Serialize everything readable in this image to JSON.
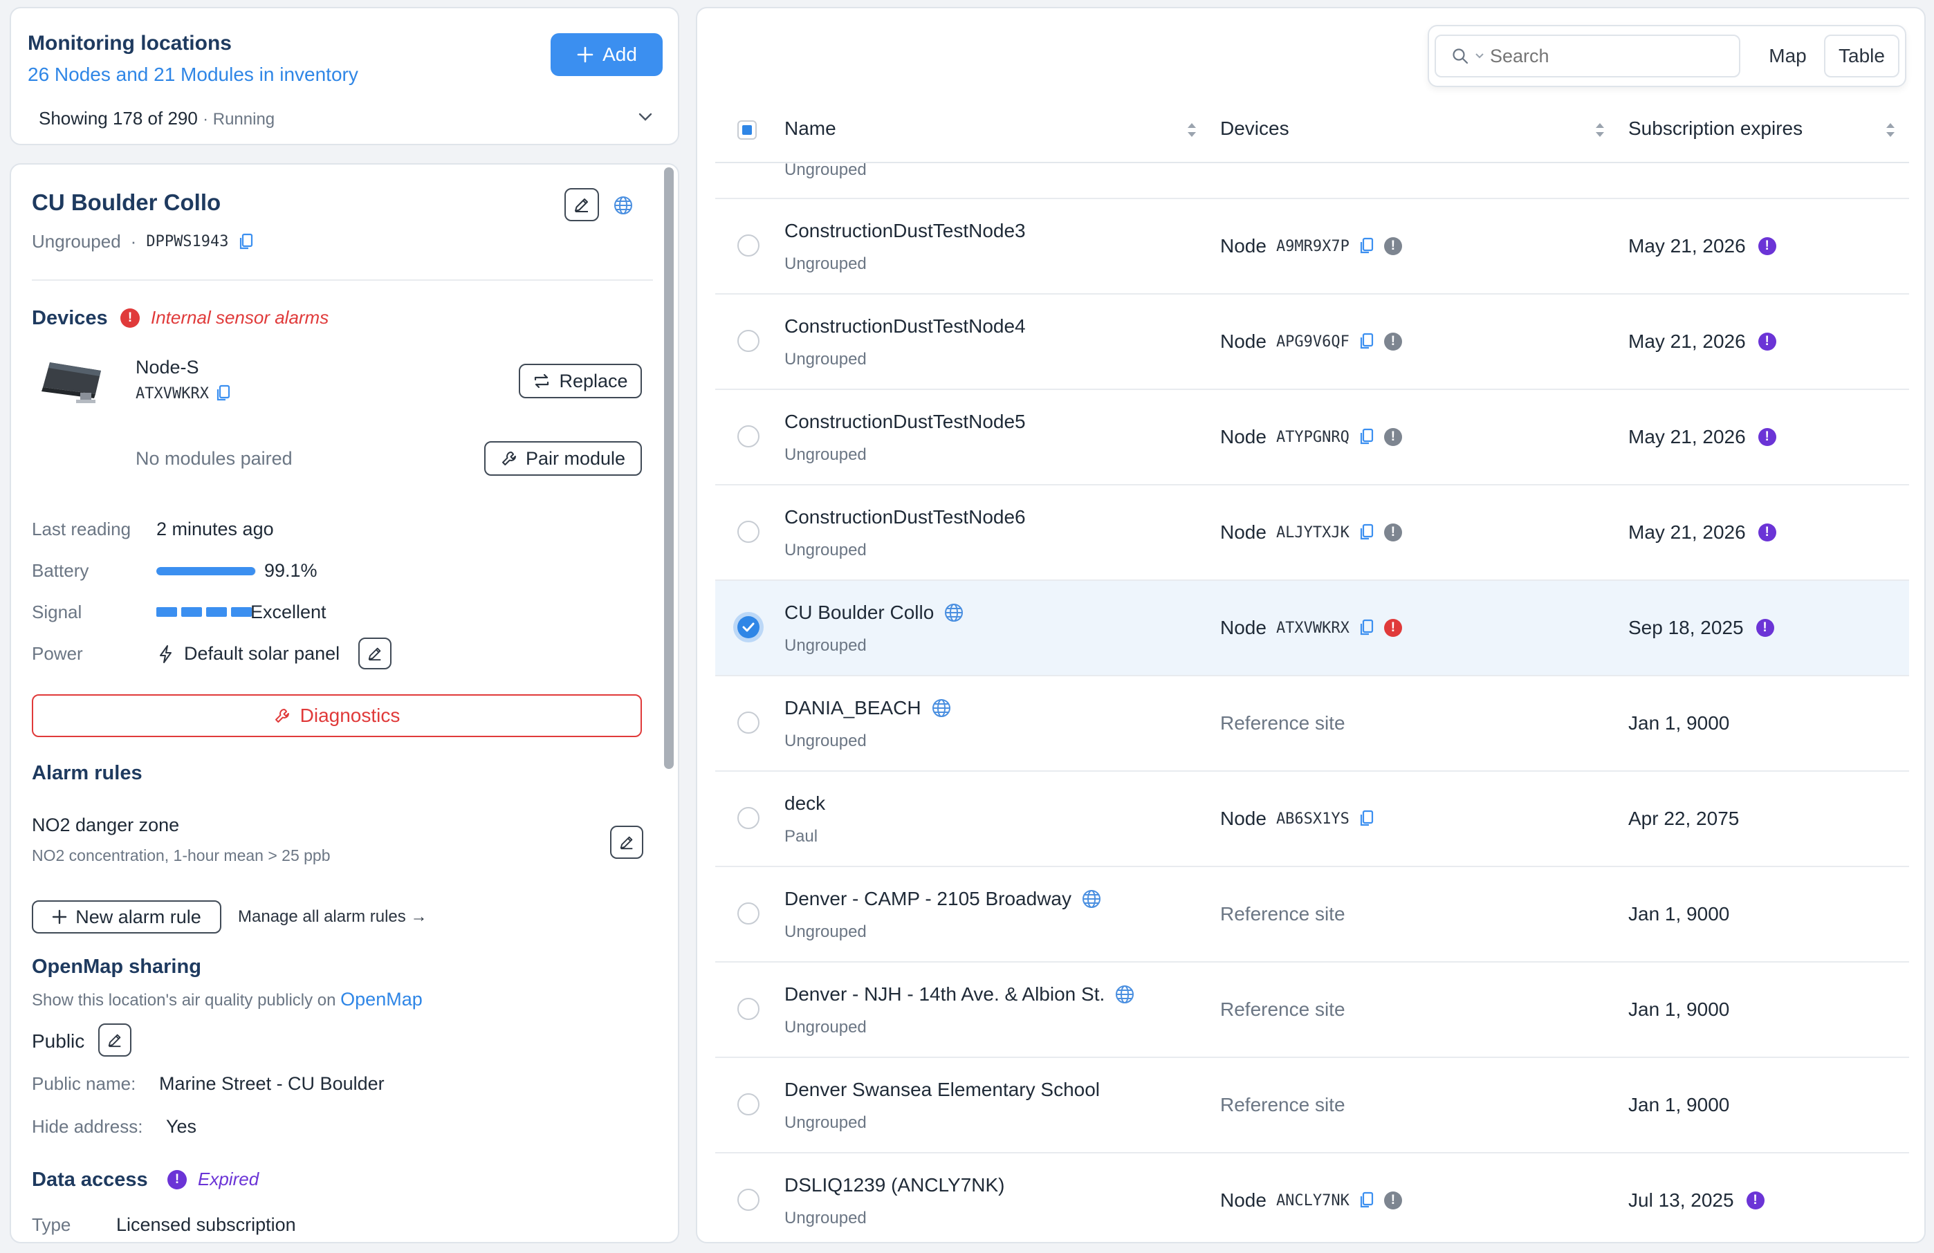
{
  "monitoring": {
    "title": "Monitoring locations",
    "subtitle": "26 Nodes and 21 Modules in inventory",
    "add_label": "Add",
    "showing": "Showing 178 of 290",
    "status": "· Running"
  },
  "detail": {
    "name": "CU Boulder Collo",
    "group": "Ungrouped",
    "sep": "·",
    "serial": "DPPWS1943",
    "devices_heading": "Devices",
    "alarm_text": "Internal sensor alarms",
    "device_model": "Node-S",
    "device_serial": "ATXVWKRX",
    "replace_label": "Replace",
    "no_modules": "No modules paired",
    "pair_label": "Pair module",
    "last_reading_label": "Last reading",
    "last_reading_value": "2 minutes ago",
    "battery_label": "Battery",
    "battery_value": "99.1%",
    "battery_fraction": 0.991,
    "signal_label": "Signal",
    "signal_value": "Excellent",
    "signal_bars": 4,
    "power_label": "Power",
    "power_value": "Default solar panel",
    "diagnostics_label": "Diagnostics",
    "alarm_rules_heading": "Alarm rules",
    "rule_name": "NO2 danger zone",
    "rule_desc": "NO2 concentration, 1-hour mean > 25 ppb",
    "new_rule_label": "New alarm rule",
    "manage_rules_label": "Manage all alarm rules →",
    "openmap_heading": "OpenMap sharing",
    "openmap_desc": "Show this location's air quality publicly on",
    "openmap_link": "OpenMap",
    "public_label": "Public",
    "public_name_label": "Public name:",
    "public_name_value": "Marine Street - CU Boulder",
    "hide_address_label": "Hide address:",
    "hide_address_value": "Yes",
    "data_access_heading": "Data access",
    "data_access_status": "Expired",
    "type_label": "Type",
    "type_value": "Licensed subscription"
  },
  "toolbar": {
    "search_placeholder": "Search",
    "map_label": "Map",
    "table_label": "Table"
  },
  "table": {
    "col_name": "Name",
    "col_devices": "Devices",
    "col_expires": "Subscription expires",
    "partial_group": "Ungrouped",
    "rows": [
      {
        "name": "ConstructionDustTestNode3",
        "group": "Ungrouped",
        "device_type": "Node",
        "device_id": "A9MR9X7P",
        "status": "gray",
        "expires": "May 21, 2026",
        "exp_alert": true,
        "globe": false,
        "selected": false
      },
      {
        "name": "ConstructionDustTestNode4",
        "group": "Ungrouped",
        "device_type": "Node",
        "device_id": "APG9V6QF",
        "status": "gray",
        "expires": "May 21, 2026",
        "exp_alert": true,
        "globe": false,
        "selected": false
      },
      {
        "name": "ConstructionDustTestNode5",
        "group": "Ungrouped",
        "device_type": "Node",
        "device_id": "ATYPGNRQ",
        "status": "gray",
        "expires": "May 21, 2026",
        "exp_alert": true,
        "globe": false,
        "selected": false
      },
      {
        "name": "ConstructionDustTestNode6",
        "group": "Ungrouped",
        "device_type": "Node",
        "device_id": "ALJYTXJK",
        "status": "gray",
        "expires": "May 21, 2026",
        "exp_alert": true,
        "globe": false,
        "selected": false
      },
      {
        "name": "CU Boulder Collo",
        "group": "Ungrouped",
        "device_type": "Node",
        "device_id": "ATXVWKRX",
        "status": "red",
        "expires": "Sep 18, 2025",
        "exp_alert": true,
        "globe": true,
        "selected": true
      },
      {
        "name": "DANIA_BEACH",
        "group": "Ungrouped",
        "device_type": "Reference site",
        "device_id": "",
        "status": "",
        "expires": "Jan 1, 9000",
        "exp_alert": false,
        "globe": true,
        "selected": false
      },
      {
        "name": "deck",
        "group": "Paul",
        "device_type": "Node",
        "device_id": "AB6SX1YS",
        "status": "",
        "expires": "Apr 22, 2075",
        "exp_alert": false,
        "globe": false,
        "selected": false
      },
      {
        "name": "Denver - CAMP - 2105 Broadway",
        "group": "Ungrouped",
        "device_type": "Reference site",
        "device_id": "",
        "status": "",
        "expires": "Jan 1, 9000",
        "exp_alert": false,
        "globe": true,
        "selected": false
      },
      {
        "name": "Denver - NJH - 14th Ave. & Albion St.",
        "group": "Ungrouped",
        "device_type": "Reference site",
        "device_id": "",
        "status": "",
        "expires": "Jan 1, 9000",
        "exp_alert": false,
        "globe": true,
        "selected": false
      },
      {
        "name": "Denver Swansea Elementary School",
        "group": "Ungrouped",
        "device_type": "Reference site",
        "device_id": "",
        "status": "",
        "expires": "Jan 1, 9000",
        "exp_alert": false,
        "globe": false,
        "selected": false
      },
      {
        "name": "DSLIQ1239 (ANCLY7NK)",
        "group": "Ungrouped",
        "device_type": "Node",
        "device_id": "ANCLY7NK",
        "status": "gray",
        "expires": "Jul 13, 2025",
        "exp_alert": true,
        "globe": false,
        "selected": false
      }
    ]
  },
  "colors": {
    "accent": "#3b8ff0",
    "link": "#2f86e6",
    "heading": "#1e3a5f",
    "danger": "#e03a3a",
    "expired": "#6b34d6",
    "selected_row": "#eef5fc"
  }
}
